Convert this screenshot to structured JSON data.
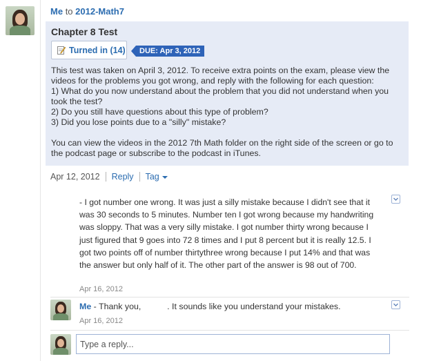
{
  "header": {
    "author": "Me",
    "to_word": "to",
    "group": "2012-Math7"
  },
  "post": {
    "title": "Chapter 8 Test",
    "turned_in_label": "Turned in (14)",
    "due_label": "DUE: Apr 3, 2012",
    "body": "This test was taken on April 3, 2012. To receive extra points on the exam, please view the videos for the problems you got wrong, and reply with the following for each question:\n1) What do you now understand about the problem that you did not understand when you took the test?\n2) Do you still have questions about this type of problem?\n3) Did you lose points due to a \"silly\" mistake?\n\nYou can view the videos in the 2012 7th Math folder on the right side of the screen or go to the podcast page or subscribe to the podcast in iTunes.",
    "date": "Apr 12, 2012",
    "reply_label": "Reply",
    "tag_label": "Tag",
    "tag_icon": "caret-down-icon"
  },
  "replies": [
    {
      "author": "",
      "text": "- I got number one wrong. It was just a silly mistake because I didn't see that it was 30 seconds to 5 minutes. Number ten I got wrong because my handwriting was sloppy. That was a very silly mistake. I got number thirty wrong because I just figured that 9 goes into 72 8 times and I put 8 percent but it is really 12.5. I got two points off of number thirtythree wrong because I put 14% and that was the answer but only half of it. The other part of the answer is 98 out of 700.",
      "date": "Apr 16, 2012"
    },
    {
      "author": "Me",
      "text": " - Thank you,           . It sounds like you understand your mistakes.",
      "date": "Apr 16, 2012"
    }
  ],
  "reply_box": {
    "placeholder": "Type a reply..."
  },
  "colors": {
    "link": "#2b6cb0",
    "post_bg": "#e6ebf6",
    "due_badge": "#2e63b8"
  }
}
